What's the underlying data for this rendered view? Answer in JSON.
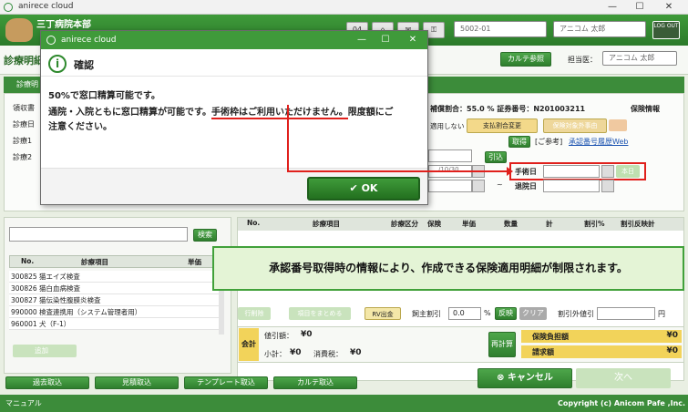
{
  "window": {
    "title": "anirece cloud",
    "minimize": "—",
    "maximize": "☐",
    "close": "✕"
  },
  "header": {
    "clinic": "三丁病院本部",
    "btn_a": "04",
    "code_value": "5002-01",
    "user_value": "アニコム 太郎",
    "logout": "LOG OUT"
  },
  "page": {
    "title": "診療明細",
    "karte_button": "カルテ参照",
    "doctor_label": "担当医：",
    "doctor_value": "アニコム 太郎"
  },
  "section": {
    "label": "診療明"
  },
  "left_labels": [
    "領収書",
    "診療日",
    "診療1",
    "診療2"
  ],
  "info": {
    "ratio": "補償割合：55.0 % 証券番号：N201003211",
    "insurance_info": "保険情報",
    "not_apply": "適用しない",
    "change_btn": "支払割合変更",
    "reason_btn": "保険対象外事由",
    "fetch_btn": "取得",
    "reference": "[ご参考]",
    "history_link": "承認番号履歴Web",
    "pull_btn": "引込",
    "date_partial": "/10/30",
    "dash": "~",
    "surgery_label": "手術日",
    "today_btn": "本日",
    "discharge_label": "退院日"
  },
  "left_table": {
    "search_btn": "検索",
    "col_no": "No.",
    "col_item": "診療項目",
    "col_price": "単価",
    "rows": [
      "300825 猫エイズ検査",
      "300826 猫白血病検査",
      "300827 猫伝染性腹膜炎検査",
      "990000 検査連携用（システム管理者用）",
      "960001 犬（F-1）"
    ],
    "add_btn": "追加"
  },
  "right_table": {
    "cols": [
      "No.",
      "診療項目",
      "診療区分",
      "保険",
      "単価",
      "数量",
      "計",
      "割引%",
      "割引反映計"
    ],
    "del_btn": "行削除",
    "merge_btn": "項目をまとめる",
    "rv_btn": "RV出金",
    "discount_label": "飼主割引",
    "discount_value": "0.0",
    "pct": "%",
    "apply_btn": "反映",
    "clear_btn": "クリア",
    "extra_label": "割引外値引",
    "yen": "円"
  },
  "totals": {
    "label": "会計",
    "price_label": "値引額：",
    "price_value": "¥0",
    "subtotal_label": "小計：",
    "subtotal_value": "¥0",
    "tax_label": "消費税：",
    "tax_value": "¥0",
    "recalc": "再計算",
    "ins_label": "保険負担額",
    "ins_value": "¥0",
    "bill_label": "請求額",
    "bill_value": "¥0"
  },
  "footer_buttons": [
    "過去取込",
    "見積取込",
    "テンプレート取込",
    "カルテ取込"
  ],
  "cancel_btn": "キャンセル",
  "next_btn": "次へ",
  "bottom": {
    "manual": "マニュアル",
    "copyright": "Copyright (c) Anicom Pafe ,Inc."
  },
  "dialog": {
    "title": "anirece cloud",
    "heading": "確認",
    "line1": "50%で窓口精算可能です。",
    "line2a": "通院・入院ともに窓口精算が可能です。",
    "line2b": "手術枠はご利用いただけません。",
    "line2c": "限度額にご",
    "line3": "注意ください。",
    "ok": "OK"
  },
  "banner": {
    "text": "承認番号取得時の情報により、作成できる保険適用明細が制限されます。"
  },
  "colors": {
    "green": "#3f9a3a",
    "red": "#e0201c"
  }
}
